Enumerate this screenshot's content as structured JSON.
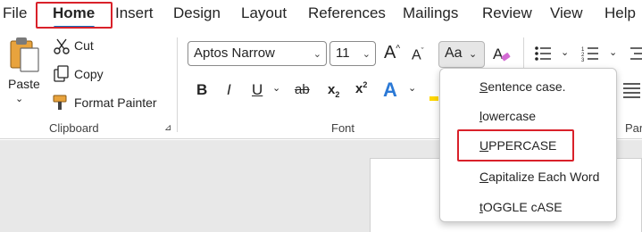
{
  "tabs": [
    "File",
    "Home",
    "Insert",
    "Design",
    "Layout",
    "References",
    "Mailings",
    "Review",
    "View",
    "Help"
  ],
  "clipboard": {
    "paste_label": "Paste",
    "cut_label": "Cut",
    "copy_label": "Copy",
    "format_painter_label": "Format Painter",
    "group_label": "Clipboard"
  },
  "font": {
    "font_name": "Aptos Narrow",
    "font_size": "11",
    "case_button_label": "Aa",
    "group_label": "Font"
  },
  "paragraph": {
    "group_label": "Par"
  },
  "change_case_menu": {
    "items": [
      {
        "accel": "S",
        "rest": "entence case."
      },
      {
        "accel": "l",
        "rest": "owercase"
      },
      {
        "accel": "U",
        "rest": "PPERCASE"
      },
      {
        "accel": "C",
        "rest": "apitalize Each Word"
      },
      {
        "accel": "t",
        "rest": "OGGLE cASE"
      }
    ]
  },
  "colors": {
    "accent": "#0f6cbd",
    "highlight_box": "#d9212a"
  }
}
